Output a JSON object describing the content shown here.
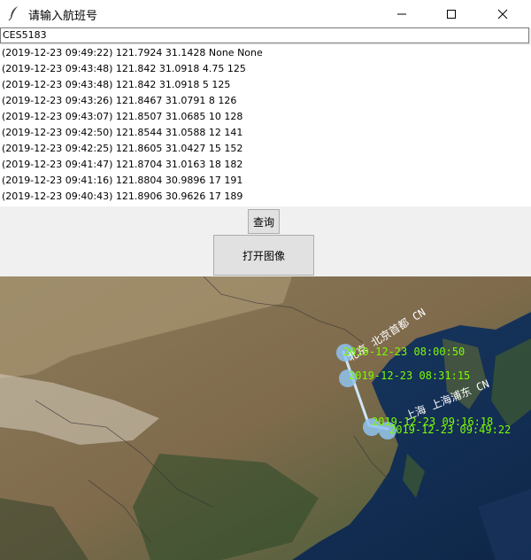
{
  "window": {
    "title": "请输入航班号"
  },
  "entry": {
    "value": "CES5183"
  },
  "results": [
    "(2019-12-23 09:49:22) 121.7924 31.1428 None None",
    "(2019-12-23 09:43:48) 121.842 31.0918 4.75 125",
    "(2019-12-23 09:43:48) 121.842 31.0918 5 125",
    "(2019-12-23 09:43:26) 121.8467 31.0791 8 126",
    "(2019-12-23 09:43:07) 121.8507 31.0685 10 128",
    "(2019-12-23 09:42:50) 121.8544 31.0588 12 141",
    "(2019-12-23 09:42:25) 121.8605 31.0427 15 152",
    "(2019-12-23 09:41:47) 121.8704 31.0163 18 182",
    "(2019-12-23 09:41:16) 121.8804 30.9896 17 191",
    "(2019-12-23 09:40:43) 121.8906 30.9626 17 189"
  ],
  "buttons": {
    "query": "查询",
    "open_image": "打开图像"
  },
  "map": {
    "city_labels": [
      "北京 北京首都 CN",
      "上海 上海浦东 CN"
    ],
    "time_labels": [
      "2019-12-23 08:00:50",
      "2019-12-23 08:31:15",
      "2019-12-23 09:16:18",
      "2019-12-23 09:49:22"
    ],
    "colors": {
      "route": "#cfe6f6",
      "point": "#8fc3ee",
      "time_text": "#7cfc00",
      "city_text": "#ffffff"
    }
  }
}
